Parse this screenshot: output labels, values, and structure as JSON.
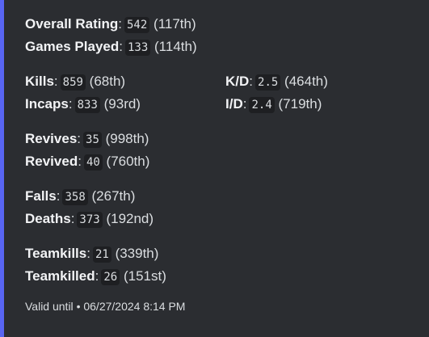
{
  "stats": {
    "overall_rating": {
      "label": "Overall Rating",
      "value": "542",
      "rank": "(117th)"
    },
    "games_played": {
      "label": "Games Played",
      "value": "133",
      "rank": "(114th)"
    },
    "kills": {
      "label": "Kills",
      "value": "859",
      "rank": "(68th)"
    },
    "kd": {
      "label": "K/D",
      "value": "2.5",
      "rank": "(464th)"
    },
    "incaps": {
      "label": "Incaps",
      "value": "833",
      "rank": "(93rd)"
    },
    "id": {
      "label": "I/D",
      "value": "2.4",
      "rank": "(719th)"
    },
    "revives": {
      "label": "Revives",
      "value": "35",
      "rank": "(998th)"
    },
    "revived": {
      "label": "Revived",
      "value": "40",
      "rank": "(760th)"
    },
    "falls": {
      "label": "Falls",
      "value": "358",
      "rank": "(267th)"
    },
    "deaths": {
      "label": "Deaths",
      "value": "373",
      "rank": "(192nd)"
    },
    "teamkills": {
      "label": "Teamkills",
      "value": "21",
      "rank": "(339th)"
    },
    "teamkilled": {
      "label": "Teamkilled",
      "value": "26",
      "rank": "(151st)"
    }
  },
  "footer": {
    "text": "Valid until",
    "separator": "•",
    "timestamp": "06/27/2024 8:14 PM"
  },
  "colors": {
    "accent_bar": "#5865f2",
    "embed_background": "#2b2d31",
    "code_background": "#1e1f22"
  }
}
